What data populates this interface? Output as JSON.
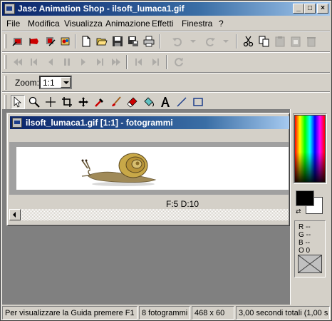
{
  "window": {
    "title": "Jasc Animation Shop - ilsoft_lumaca1.gif",
    "minimize": "_",
    "maximize": "□",
    "close": "×"
  },
  "menu": [
    "File",
    "Modifica",
    "Visualizza",
    "Animazione",
    "Effetti",
    "Finestra",
    "?"
  ],
  "zoom": {
    "label": "Zoom:",
    "value": "1:1"
  },
  "document": {
    "title": "ilsoft_lumaca1.gif [1:1] - fotogrammi",
    "frame_info": "F:5  D:10"
  },
  "color_panel": {
    "r": "R --",
    "g": "G --",
    "b": "B --",
    "o": "O 0",
    "foreground": "#000000",
    "background": "#ffffff"
  },
  "status": {
    "help": "Per visualizzare la Guida premere F1",
    "frames": "8 fotogrammi",
    "size": "468 x 60",
    "duration": "3,00 secondi totali (1,00 s"
  },
  "icons": {
    "toolbar1": [
      "animation-wizard-icon",
      "banner-wizard-icon",
      "optimization-wizard-icon",
      "paint-shop-pro-icon",
      "new-icon",
      "open-icon",
      "save-icon",
      "save-as-icon",
      "print-icon",
      "undo-icon",
      "redo-icon",
      "cut-icon",
      "copy-icon",
      "paste-icon",
      "paste-frame-icon",
      "delete-icon"
    ],
    "toolbar2": [
      "first-frame-icon",
      "prev-frame-icon",
      "step-back-icon",
      "pause-icon",
      "play-icon",
      "step-forward-icon",
      "last-frame-icon",
      "prev-page-icon",
      "next-page-icon",
      "refresh-icon"
    ],
    "toolbar3": [
      "select-arrow-icon",
      "zoom-icon",
      "crosshair-icon",
      "crop-icon",
      "move-icon",
      "dropper-icon",
      "brush-icon",
      "eraser-icon",
      "fill-icon",
      "text-icon",
      "line-icon",
      "rectangle-icon"
    ]
  }
}
